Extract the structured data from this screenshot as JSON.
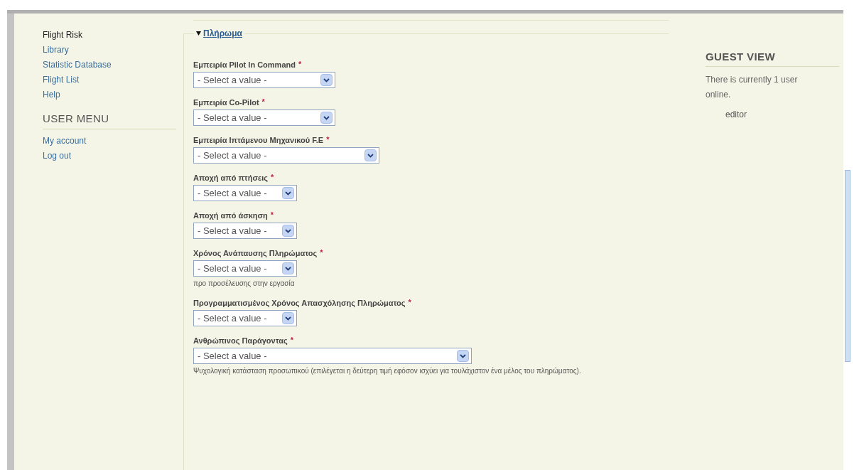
{
  "sidebar": {
    "items": [
      {
        "label": "Flight Risk",
        "selected": true
      },
      {
        "label": "Library",
        "selected": false
      },
      {
        "label": "Statistic Database",
        "selected": false
      },
      {
        "label": "Flight List",
        "selected": false
      },
      {
        "label": "Help",
        "selected": false
      }
    ],
    "user_menu": {
      "title": "USER MENU",
      "items": [
        {
          "label": "My account"
        },
        {
          "label": "Log out"
        }
      ]
    }
  },
  "fieldset": {
    "legend": "Πλήρωμα",
    "expanded": true,
    "fields": [
      {
        "label": "Εμπειρία Pilot In Command",
        "required": "*",
        "value": "- Select a value -"
      },
      {
        "label": "Εμπειρία Co-Pilot",
        "required": "*",
        "value": "- Select a value -"
      },
      {
        "label": "Εμπειρία Ιπτάμενου Μηχανικού F.E",
        "required": "*",
        "value": "- Select a value -"
      },
      {
        "label": "Αποχή από πτήσεις",
        "required": "*",
        "value": "- Select a value -"
      },
      {
        "label": "Αποχή από άσκηση",
        "required": "*",
        "value": "- Select a value -"
      },
      {
        "label": "Χρόνος Ανάπαυσης Πληρώματος",
        "required": "*",
        "value": "- Select a value -",
        "description": "προ προσέλευσης στην εργασία"
      },
      {
        "label": "Προγραμματισμένος Χρόνος Απασχόλησης Πληρώματος",
        "required": "*",
        "value": "- Select a value -"
      },
      {
        "label": "Ανθρώπινος Παράγοντας",
        "required": "*",
        "value": "- Select a value -",
        "description": "Ψυχολογική κατάσταση προσωπικού (επιλέγεται η δεύτερη τιμή εφόσον ισχύει για τουλάχιστον ένα μέλος του πληρώματος)."
      }
    ]
  },
  "guest_view": {
    "title": "GUEST VIEW",
    "text": "There is currently 1 user online.",
    "users": [
      "editor"
    ]
  }
}
